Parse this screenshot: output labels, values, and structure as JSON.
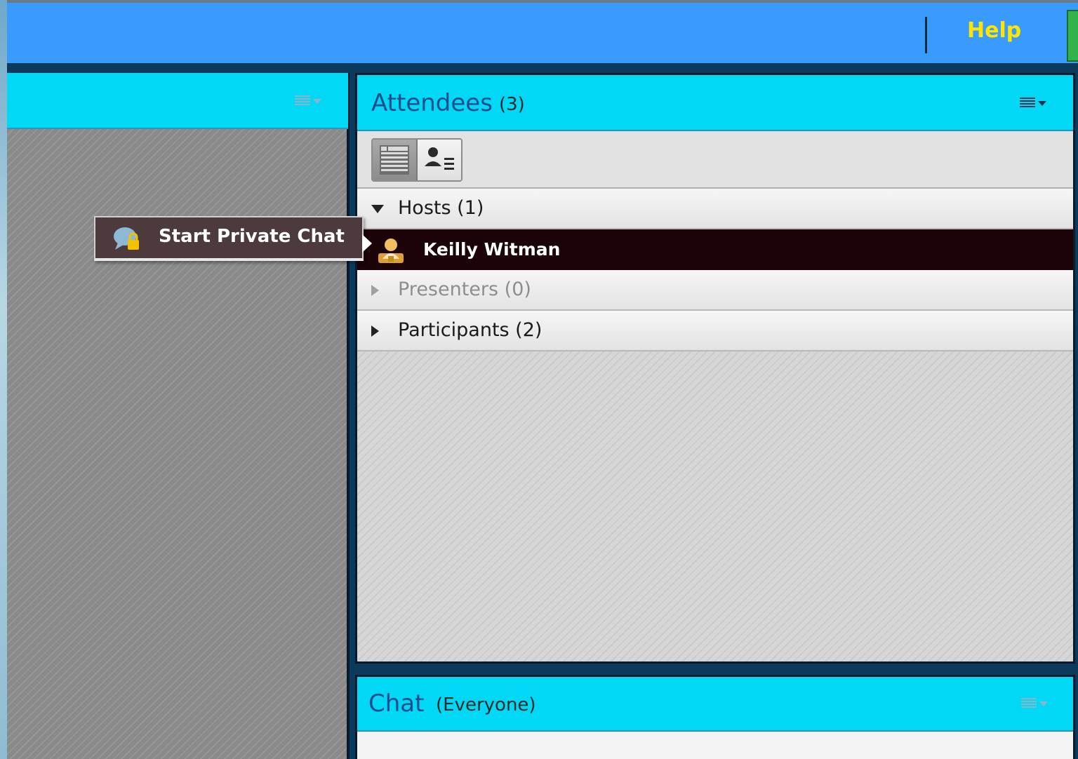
{
  "topbar": {
    "help_label": "Help",
    "status_color": "#2fb34a"
  },
  "context_menu": {
    "items": [
      {
        "label": "Start Private Chat",
        "icon": "private-chat-icon"
      }
    ]
  },
  "attendees_pod": {
    "title": "Attendees",
    "count": "(3)",
    "view_modes": [
      "list-view-icon",
      "attendee-detail-view-icon"
    ],
    "groups": {
      "hosts": {
        "label": "Hosts (1)",
        "expanded": true
      },
      "presenters": {
        "label": "Presenters (0)",
        "expanded": false
      },
      "participants": {
        "label": "Participants (2)",
        "expanded": false
      }
    },
    "hosts": [
      {
        "name": "Keilly Witman",
        "icon": "host-icon",
        "selected": true
      }
    ]
  },
  "chat_pod": {
    "title": "Chat",
    "subtitle": "(Everyone)"
  },
  "colors": {
    "topbar": "#3a9bff",
    "pod_header": "#00d8f6",
    "help": "#ffe600",
    "selected_row": "#1c0307",
    "title_text": "#1f4d8c"
  }
}
